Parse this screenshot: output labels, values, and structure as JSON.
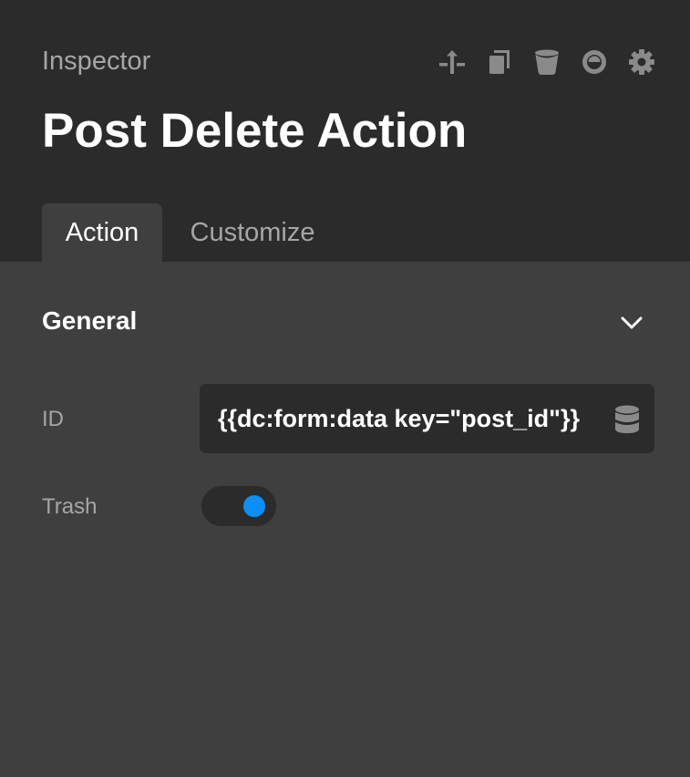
{
  "header": {
    "inspector_label": "Inspector",
    "title": "Post Delete Action",
    "toolbar": [
      {
        "name": "move-up-icon"
      },
      {
        "name": "duplicate-icon"
      },
      {
        "name": "trash-icon"
      },
      {
        "name": "eye-icon"
      },
      {
        "name": "gear-icon"
      }
    ]
  },
  "tabs": [
    {
      "label": "Action",
      "active": true
    },
    {
      "label": "Customize",
      "active": false
    }
  ],
  "section": {
    "title": "General",
    "icon": "chevron-down-icon"
  },
  "fields": {
    "id": {
      "label": "ID",
      "value": "{{dc:form:data key=\"post_id\"}}",
      "icon": "database-icon"
    },
    "trash": {
      "label": "Trash",
      "enabled": true
    }
  },
  "colors": {
    "header_bg": "#2b2b2b",
    "panel_bg": "#3f3f3f",
    "accent": "#0c8ef7",
    "muted_text": "#a6a6a6",
    "icon_color": "#8a8a8a"
  }
}
